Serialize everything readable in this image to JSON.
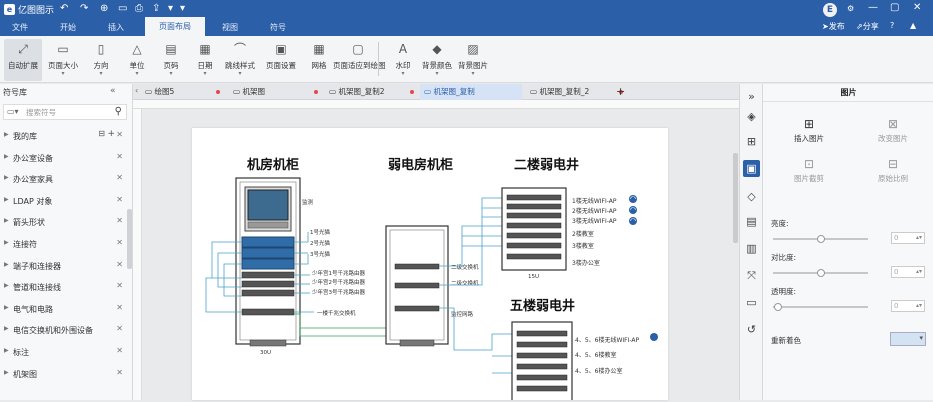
{
  "app": {
    "title": "亿图图示",
    "logo_letter": "e"
  },
  "quick_access": {
    "undo": "↶",
    "redo": "↷",
    "print": "⎙",
    "export": "⇪"
  },
  "menu": [
    "文件",
    "开始",
    "插入",
    "页面布局",
    "视图",
    "符号"
  ],
  "menu_active": "页面布局",
  "user": {
    "avatar": "E",
    "publish": "发布",
    "share": "分享"
  },
  "ribbon": [
    {
      "label": "自动扩展",
      "icon": "auto-expand-icon",
      "glyph": "⤢",
      "dropdown": false
    },
    {
      "label": "页面大小",
      "icon": "page-size-icon",
      "glyph": "▭",
      "dropdown": true
    },
    {
      "label": "方向",
      "icon": "orientation-icon",
      "glyph": "▯",
      "dropdown": true
    },
    {
      "label": "单位",
      "icon": "unit-icon",
      "glyph": "△",
      "dropdown": true
    },
    {
      "label": "页码",
      "icon": "page-number-icon",
      "glyph": "▤",
      "dropdown": true
    },
    {
      "label": "日期",
      "icon": "date-icon",
      "glyph": "▦",
      "dropdown": true
    },
    {
      "label": "跳线样式",
      "icon": "jumper-style-icon",
      "glyph": "⌒",
      "dropdown": true
    },
    {
      "label": "页面设置",
      "icon": "page-setup-icon",
      "glyph": "▣",
      "dropdown": false
    },
    {
      "label": "网格",
      "icon": "grid-icon",
      "glyph": "▦",
      "dropdown": false
    },
    {
      "label": "页面适应到绘图",
      "icon": "fit-page-icon",
      "glyph": "▢",
      "dropdown": false
    },
    {
      "label": "水印",
      "icon": "watermark-icon",
      "glyph": "A",
      "dropdown": true
    },
    {
      "label": "背景颜色",
      "icon": "bg-color-icon",
      "glyph": "◆",
      "dropdown": true
    },
    {
      "label": "背景图片",
      "icon": "bg-image-icon",
      "glyph": "▨",
      "dropdown": true
    }
  ],
  "left_panel": {
    "title": "符号库",
    "search_placeholder": "搜索符号",
    "libraries": [
      "我的库",
      "办公室设备",
      "办公室家具",
      "LDAP 对象",
      "箭头形状",
      "连接符",
      "端子和连接器",
      "管道和连接线",
      "电气和电路",
      "电信交换机和外围设备",
      "标注",
      "机架图"
    ]
  },
  "tabs": [
    {
      "label": "绘图5",
      "active": false,
      "modified": true
    },
    {
      "label": "机架图",
      "active": false,
      "modified": true
    },
    {
      "label": "机架图_复制2",
      "active": false,
      "modified": true
    },
    {
      "label": "机架图_复制",
      "active": true,
      "modified": false
    },
    {
      "label": "机架图_复制_2",
      "active": false,
      "modified": true
    }
  ],
  "tab_add": "+",
  "diagram": {
    "title_room": "机房机柜",
    "title_weak": "弱电房机柜",
    "title_f2": "二楼弱电井",
    "title_f5": "五楼弱电井",
    "room_labels": [
      "监测",
      "1号光猫",
      "2号光猫",
      "3号光猫",
      "少年宫1号千兆路由器",
      "少年宫2号千兆路由器",
      "少年宫3号千兆路由器",
      "一楼千兆交换机"
    ],
    "room_unit": "30U",
    "weak_labels": [
      "二级交换机",
      "二级交换机",
      "监控网路"
    ],
    "f2_labels": [
      "1楼无线WIFI-AP",
      "2楼无线WIFI-AP",
      "3楼无线WIFI-AP",
      "2楼教室",
      "3楼教室",
      "3楼办公室"
    ],
    "f2_unit": "15U",
    "f5_labels": [
      "4、5、6楼无线WIFI-AP",
      "4、5、6楼教室",
      "4、5、6楼办公室"
    ]
  },
  "right_panel": {
    "title": "图片",
    "insert_image": "插入图片",
    "change_image": "改变图片",
    "crop_image": "图片截剪",
    "original_size": "原始比例",
    "brightness": "亮度:",
    "contrast": "对比度:",
    "transparency": "透明度:",
    "recolor": "重新着色",
    "brightness_value": "0",
    "contrast_value": "0",
    "transparency_value": "0"
  },
  "colors": {
    "accent": "#2b5fa8",
    "diagram_line": "#4aa3c9",
    "diagram_green": "#3aa55a"
  }
}
